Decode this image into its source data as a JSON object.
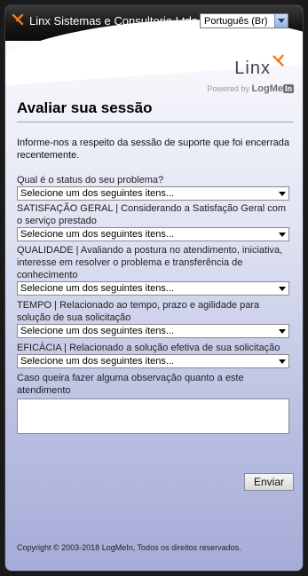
{
  "titlebar": {
    "title": "Linx Sistemas e Consultoria Ltda",
    "language_value": "Português (Br)"
  },
  "brand": {
    "logo_text": "Linx",
    "powered_prefix": "Powered by",
    "powered_name": "LogMe",
    "powered_in": "In"
  },
  "main": {
    "heading": "Avaliar sua sessão",
    "intro": "Informe-nos a respeito da sessão de suporte que foi encerrada recentemente.",
    "questions": [
      {
        "label": "Qual é o status do seu problema?",
        "value": "Selecione um dos seguintes itens..."
      },
      {
        "label": "SATISFAÇÃO GERAL | Considerando a Satisfação Geral com o serviço prestado",
        "value": "Selecione um dos seguintes itens..."
      },
      {
        "label": "QUALIDADE | Avaliando a postura no atendimento, iniciativa, interesse em resolver o problema e transferência de conhecimento",
        "value": "Selecione um dos seguintes itens..."
      },
      {
        "label": "TEMPO | Relacionado ao tempo, prazo e agilidade para solução de sua solicitação",
        "value": "Selecione um dos seguintes itens..."
      },
      {
        "label": "EFICÁCIA | Relacionado a solução efetiva de sua solicitação",
        "value": "Selecione um dos seguintes itens..."
      }
    ],
    "comment_label": "Caso queira fazer alguma observação quanto a este atendimento",
    "comment_value": "",
    "send_label": "Enviar"
  },
  "footer": {
    "copyright": "Copyright © 2003-2018 LogMeIn, Todos os direitos reservados."
  },
  "colors": {
    "accent_orange": "#f07a1a",
    "titlebar": "#151515",
    "gradient_bottom": "#a6abd8"
  },
  "icons": {
    "app_icon": "linx-logo-icon",
    "dropdown_arrow": "chevron-down-icon"
  }
}
